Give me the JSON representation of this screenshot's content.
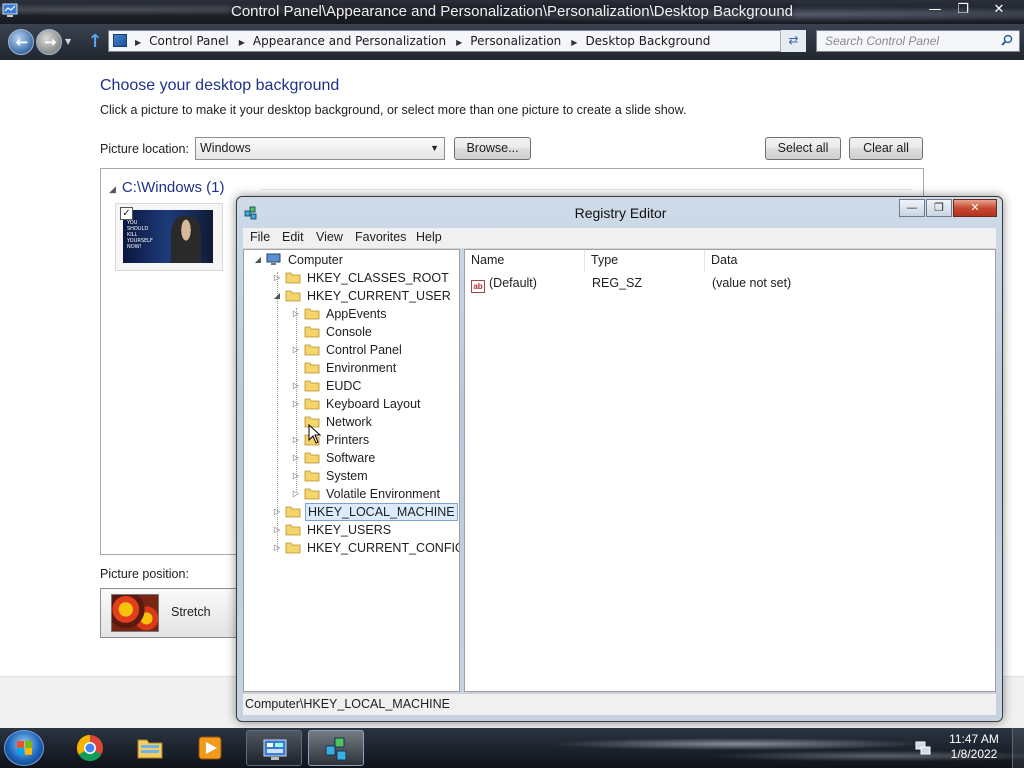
{
  "controlPanel": {
    "title": "Control Panel\\Appearance and Personalization\\Personalization\\Desktop Background",
    "breadcrumb": [
      "Control Panel",
      "Appearance and Personalization",
      "Personalization",
      "Desktop Background"
    ],
    "search_placeholder": "Search Control Panel",
    "heading": "Choose your desktop background",
    "description": "Click a picture to make it your desktop background, or select more than one picture to create a slide show.",
    "picture_location_label": "Picture location:",
    "picture_location_value": "Windows",
    "browse_label": "Browse...",
    "select_all_label": "Select all",
    "clear_all_label": "Clear all",
    "group_header": "C:\\Windows (1)",
    "thumbnail_text": "YOU SHOULD KILL YOURSELF NOW!",
    "thumbnail_checked": true,
    "picture_position_label": "Picture position:",
    "picture_position_value": "Stretch"
  },
  "registryEditor": {
    "title": "Registry Editor",
    "menu": [
      "File",
      "Edit",
      "View",
      "Favorites",
      "Help"
    ],
    "tree": {
      "root": "Computer",
      "hives": [
        "HKEY_CLASSES_ROOT",
        "HKEY_CURRENT_USER",
        "HKEY_LOCAL_MACHINE",
        "HKEY_USERS",
        "HKEY_CURRENT_CONFIG"
      ],
      "current_user_children": [
        "AppEvents",
        "Console",
        "Control Panel",
        "Environment",
        "EUDC",
        "Keyboard Layout",
        "Network",
        "Printers",
        "Software",
        "System",
        "Volatile Environment"
      ],
      "selected": "HKEY_LOCAL_MACHINE"
    },
    "columns": [
      "Name",
      "Type",
      "Data"
    ],
    "values": [
      {
        "name": "(Default)",
        "type": "REG_SZ",
        "data": "(value not set)"
      }
    ],
    "status": "Computer\\HKEY_LOCAL_MACHINE"
  },
  "taskbar": {
    "time": "11:47 AM",
    "date": "1/8/2022",
    "apps": [
      "start-orb",
      "chrome-icon",
      "explorer-icon",
      "media-player-icon",
      "control-panel-icon",
      "regedit-icon"
    ]
  },
  "colors": {
    "heading_blue": "#1e3287",
    "selection": "#dcebfc",
    "taskbar": "#1a1f27"
  }
}
